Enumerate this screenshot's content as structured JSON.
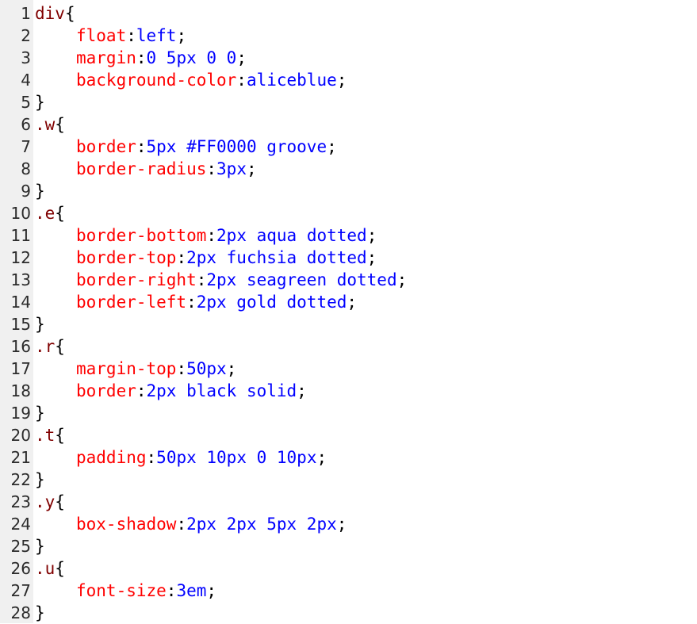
{
  "editor": {
    "language": "css",
    "colors": {
      "selector": "#800000",
      "property": "#ff0000",
      "value": "#0000ff",
      "punctuation": "#000000",
      "gutter_background": "#f0f0f0",
      "line_number": "#2b2b2b"
    },
    "lines": [
      {
        "n": "1",
        "kind": "open",
        "sel": "div",
        "open": "{"
      },
      {
        "n": "2",
        "kind": "decl",
        "prop": "float",
        "colon": ":",
        "value": "left",
        "semi": ";"
      },
      {
        "n": "3",
        "kind": "decl",
        "prop": "margin",
        "colon": ":",
        "value": "0 5px 0 0",
        "semi": ";"
      },
      {
        "n": "4",
        "kind": "decl",
        "prop": "background-color",
        "colon": ":",
        "value": "aliceblue",
        "semi": ";"
      },
      {
        "n": "5",
        "kind": "close",
        "close": "}"
      },
      {
        "n": "6",
        "kind": "open",
        "sel": ".w",
        "open": "{"
      },
      {
        "n": "7",
        "kind": "decl",
        "prop": "border",
        "colon": ":",
        "value": "5px #FF0000 groove",
        "semi": ";"
      },
      {
        "n": "8",
        "kind": "decl",
        "prop": "border-radius",
        "colon": ":",
        "value": "3px",
        "semi": ";"
      },
      {
        "n": "9",
        "kind": "close",
        "close": "}"
      },
      {
        "n": "10",
        "kind": "open",
        "sel": ".e",
        "open": "{"
      },
      {
        "n": "11",
        "kind": "decl",
        "prop": "border-bottom",
        "colon": ":",
        "value": "2px aqua dotted",
        "semi": ";"
      },
      {
        "n": "12",
        "kind": "decl",
        "prop": "border-top",
        "colon": ":",
        "value": "2px fuchsia dotted",
        "semi": ";"
      },
      {
        "n": "13",
        "kind": "decl",
        "prop": "border-right",
        "colon": ":",
        "value": "2px seagreen dotted",
        "semi": ";"
      },
      {
        "n": "14",
        "kind": "decl",
        "prop": "border-left",
        "colon": ":",
        "value": "2px gold dotted",
        "semi": ";"
      },
      {
        "n": "15",
        "kind": "close",
        "close": "}"
      },
      {
        "n": "16",
        "kind": "open",
        "sel": ".r",
        "open": "{"
      },
      {
        "n": "17",
        "kind": "decl",
        "prop": "margin-top",
        "colon": ":",
        "value": "50px",
        "semi": ";"
      },
      {
        "n": "18",
        "kind": "decl",
        "prop": "border",
        "colon": ":",
        "value": "2px black solid",
        "semi": ";"
      },
      {
        "n": "19",
        "kind": "close",
        "close": "}"
      },
      {
        "n": "20",
        "kind": "open",
        "sel": ".t",
        "open": "{"
      },
      {
        "n": "21",
        "kind": "decl",
        "prop": "padding",
        "colon": ":",
        "value": "50px 10px 0 10px",
        "semi": ";"
      },
      {
        "n": "22",
        "kind": "close",
        "close": "}"
      },
      {
        "n": "23",
        "kind": "open",
        "sel": ".y",
        "open": "{"
      },
      {
        "n": "24",
        "kind": "decl",
        "prop": "box-shadow",
        "colon": ":",
        "value": "2px 2px 5px 2px",
        "semi": ";"
      },
      {
        "n": "25",
        "kind": "close",
        "close": "}"
      },
      {
        "n": "26",
        "kind": "open",
        "sel": ".u",
        "open": "{"
      },
      {
        "n": "27",
        "kind": "decl",
        "prop": "font-size",
        "colon": ":",
        "value": "3em",
        "semi": ";"
      },
      {
        "n": "28",
        "kind": "close",
        "close": "}"
      }
    ]
  }
}
